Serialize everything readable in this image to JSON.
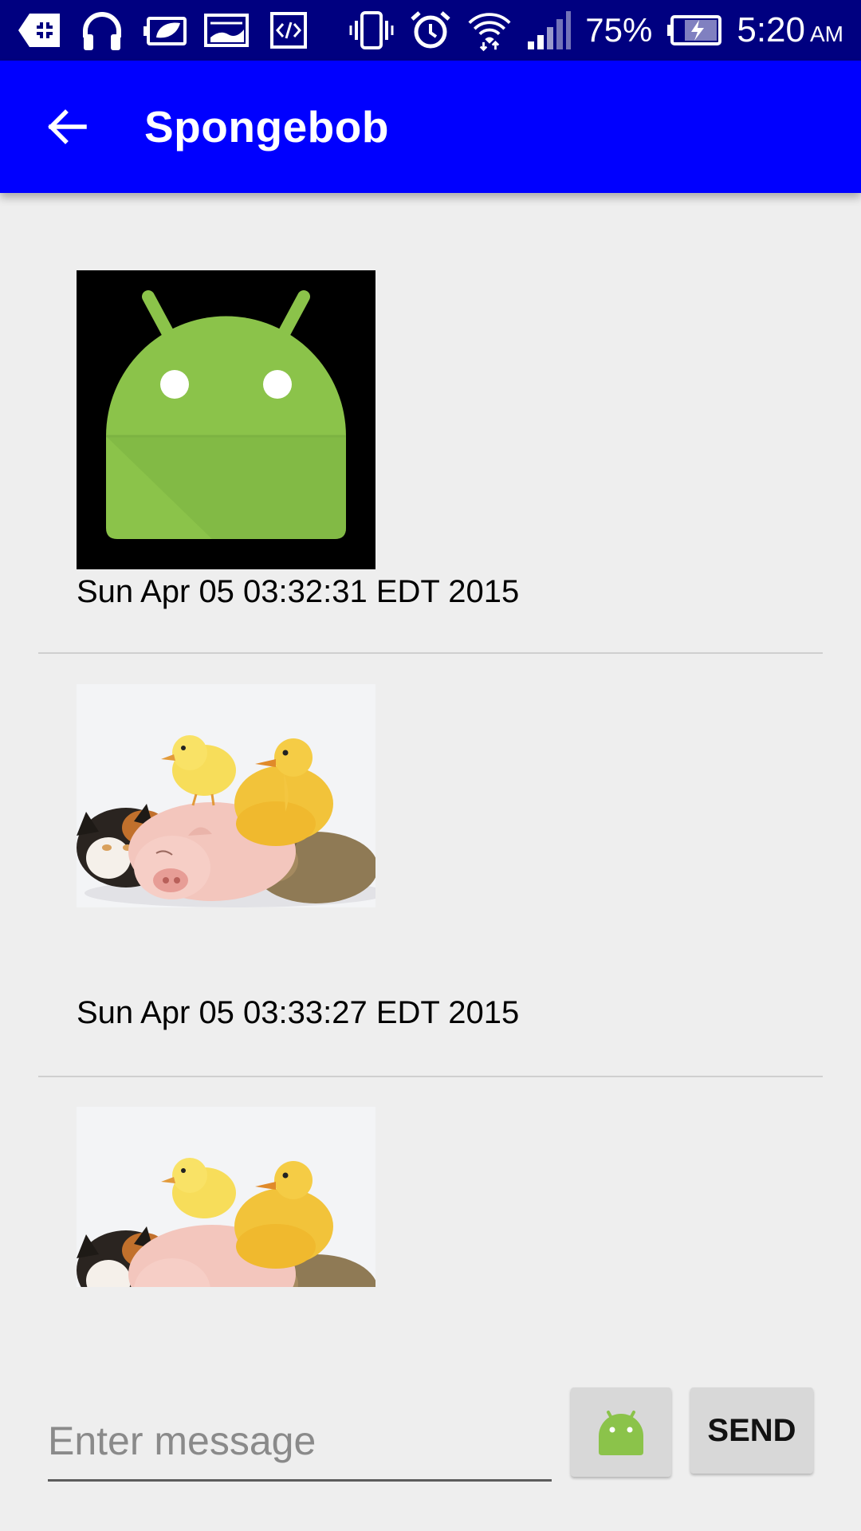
{
  "status_bar": {
    "battery_percent": "75%",
    "time": "5:20",
    "ampm": "AM",
    "icons": [
      "android-debug-icon",
      "headphones-icon",
      "leaf-battery-icon",
      "gallery-icon",
      "code-icon",
      "vibrate-icon",
      "alarm-icon",
      "wifi-icon",
      "signal-icon",
      "battery-charging-icon"
    ]
  },
  "app_bar": {
    "title": "Spongebob",
    "back_icon": "arrow-back-icon",
    "color": "#0000ff"
  },
  "messages": [
    {
      "image": "android-robot-image",
      "timestamp": "Sun Apr 05 03:32:31 EDT 2015"
    },
    {
      "image": "animals-photo-image",
      "timestamp": "Sun Apr 05 03:33:27 EDT 2015"
    },
    {
      "image": "animals-photo-image",
      "timestamp": ""
    }
  ],
  "composer": {
    "placeholder": "Enter message",
    "value": "",
    "attach_icon": "android-icon",
    "send_label": "SEND"
  },
  "colors": {
    "status_bar": "#000080",
    "android_green": "#8bc34a",
    "background": "#eeeeee"
  }
}
